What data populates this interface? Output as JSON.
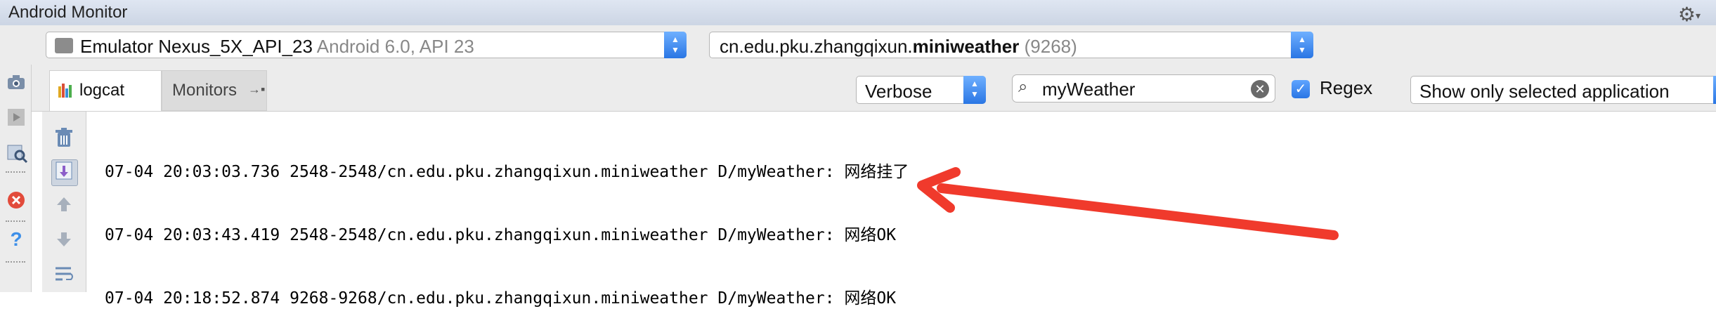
{
  "window": {
    "title": "Android Monitor"
  },
  "device": {
    "name": "Emulator Nexus_5X_API_23",
    "detail": "Android 6.0, API 23"
  },
  "process": {
    "package_prefix": "cn.edu.pku.zhangqixun.",
    "package_bold": "miniweather",
    "pid": "(9268)"
  },
  "tabs": {
    "logcat": "logcat",
    "monitors": "Monitors"
  },
  "filters": {
    "level": "Verbose",
    "search_value": "myWeather",
    "regex_label": "Regex",
    "regex_checked": true,
    "app_filter": "Show only selected application"
  },
  "log_lines": [
    "07-04 20:03:03.736 2548-2548/cn.edu.pku.zhangqixun.miniweather D/myWeather: 网络挂了",
    "07-04 20:03:43.419 2548-2548/cn.edu.pku.zhangqixun.miniweather D/myWeather: 网络OK",
    "07-04 20:18:52.874 9268-9268/cn.edu.pku.zhangqixun.miniweather D/myWeather: 网络OK"
  ],
  "colors": {
    "accent_blue": "#2a76e4",
    "annotation_arrow": "#f03a2c"
  },
  "icons": [
    "gear-icon",
    "camera-icon",
    "record-icon",
    "inspect-icon",
    "close-icon",
    "help-icon",
    "logcat-icon",
    "trash-icon",
    "scroll-end-icon",
    "up-arrow-icon",
    "down-arrow-icon",
    "wrap-icon",
    "search-icon",
    "clear-icon"
  ]
}
